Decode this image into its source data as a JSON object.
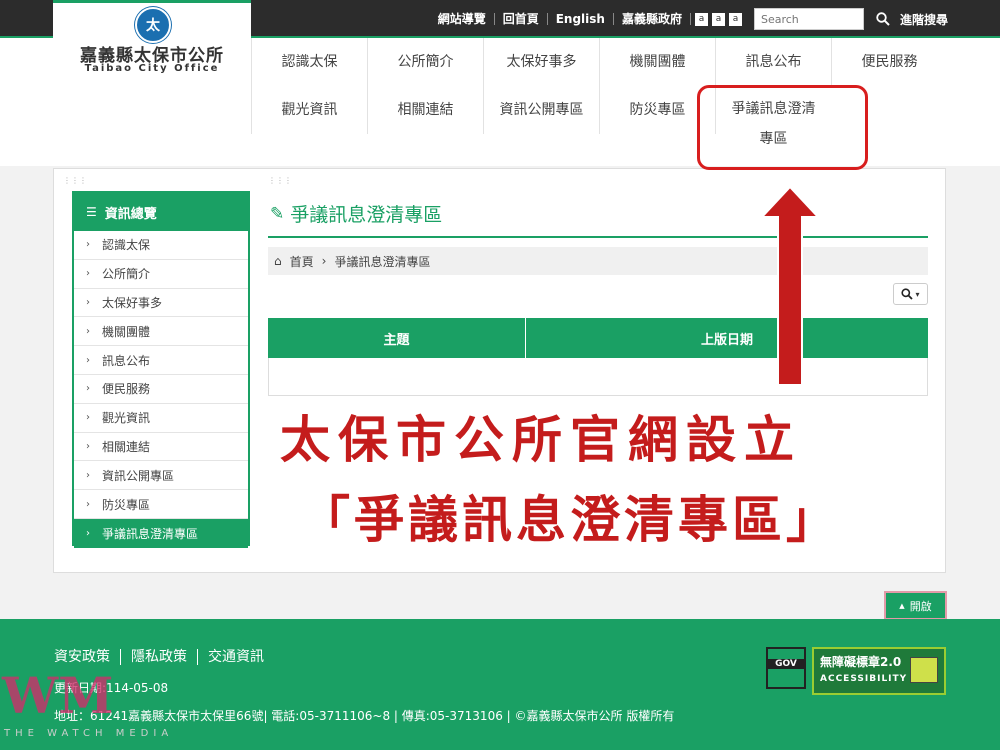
{
  "topbar": {
    "links": [
      "網站導覽",
      "回首頁",
      "English",
      "嘉義縣政府"
    ],
    "font_sizes": [
      "a",
      "a",
      "a"
    ],
    "search_placeholder": "Search",
    "advanced_search": "進階搜尋"
  },
  "logo": {
    "name": "嘉義縣太保市公所",
    "english": "Taibao City Office",
    "icon": "city-emblem"
  },
  "nav": {
    "row1": [
      "認識太保",
      "公所簡介",
      "太保好事多",
      "機關團體",
      "訊息公布",
      "便民服務"
    ],
    "row2": [
      "觀光資訊",
      "相關連結",
      "資訊公開專區",
      "防災專區",
      "爭議訊息澄清\n專區"
    ]
  },
  "sidebar": {
    "heading": "資訊總覽",
    "items": [
      {
        "label": "認識太保"
      },
      {
        "label": "公所簡介"
      },
      {
        "label": "太保好事多"
      },
      {
        "label": "機關團體"
      },
      {
        "label": "訊息公布"
      },
      {
        "label": "便民服務"
      },
      {
        "label": "觀光資訊"
      },
      {
        "label": "相關連結"
      },
      {
        "label": "資訊公開專區"
      },
      {
        "label": "防災專區"
      },
      {
        "label": "爭議訊息澄清專區"
      }
    ]
  },
  "content": {
    "title": "爭議訊息澄清專區",
    "breadcrumb": [
      "首頁",
      "爭議訊息澄清專區"
    ],
    "table_headers": [
      "主題",
      "上版日期"
    ]
  },
  "annotation": {
    "line1": "太保市公所官網設立",
    "line2": "「爭議訊息澄清專區」",
    "color": "#c41c1c"
  },
  "open_button": "開啟",
  "footer": {
    "links": [
      "資安政策",
      "隱私政策",
      "交通資訊"
    ],
    "update": "更新日期:114-05-08",
    "address": "地址：61241嘉義縣太保市太保里66號| 電話:05-3711106~8 | 傳真:05-3713106 | ©嘉義縣太保市公所 版權所有",
    "gov_badge": "GOV",
    "access_title": "無障礙標章2.0",
    "access_sub": "ACCESSIBILITY"
  },
  "watermark": {
    "mark": "WM",
    "text": "THE WATCH MEDIA"
  },
  "colors": {
    "brand_green": "#1aa064",
    "dark_bar": "#2c2c2c"
  }
}
